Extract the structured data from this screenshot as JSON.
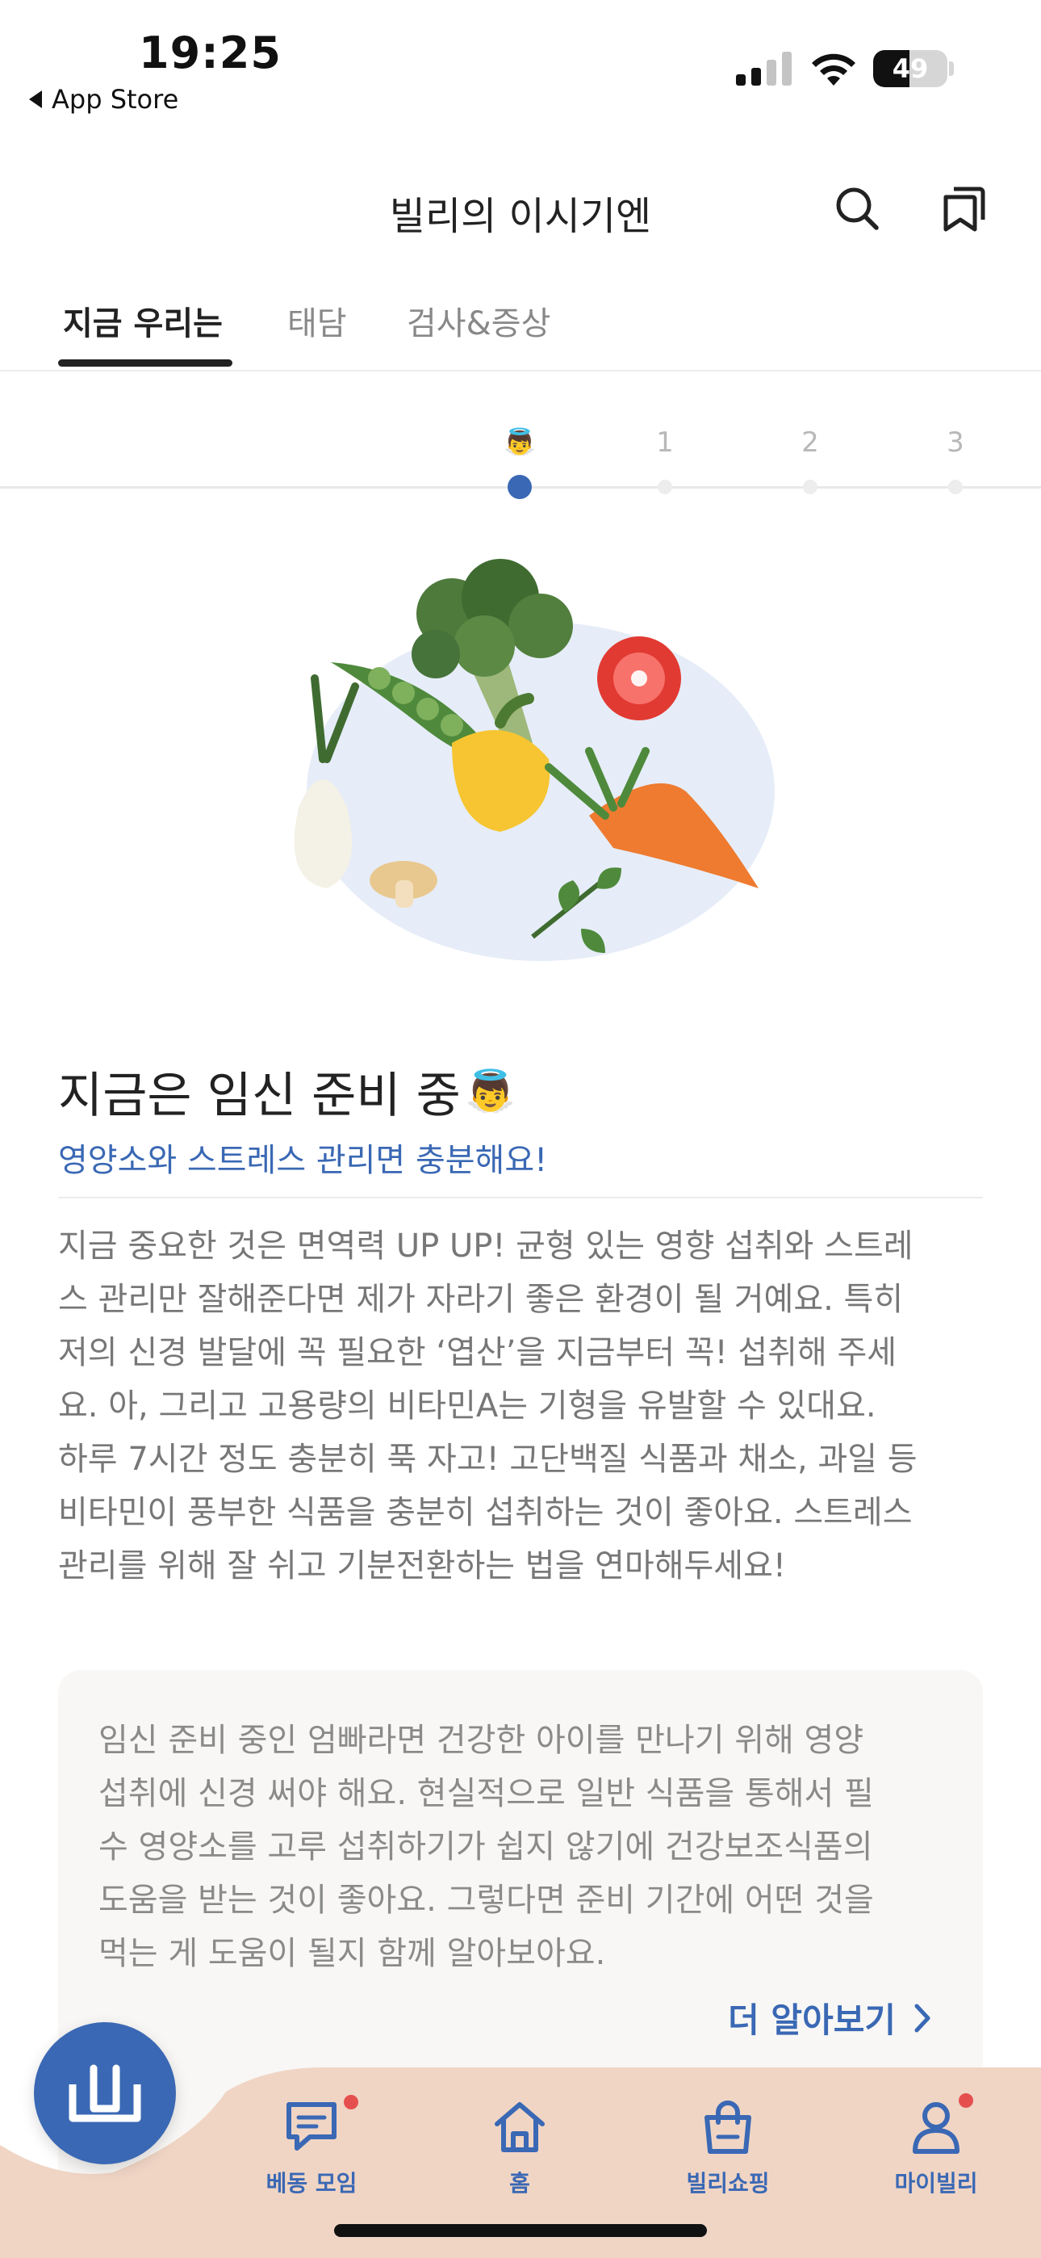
{
  "status_bar": {
    "time": "19:25",
    "back_label": "App Store",
    "battery": "49"
  },
  "header": {
    "title": "빌리의 이시기엔",
    "icons": [
      "search-icon",
      "bookmark-icon"
    ]
  },
  "tabs": [
    {
      "label": "지금 우리는",
      "active": true
    },
    {
      "label": "태담",
      "active": false
    },
    {
      "label": "검사&증상",
      "active": false
    }
  ],
  "timeline": {
    "steps": [
      "👼",
      "1",
      "2",
      "3"
    ],
    "active_index": 0
  },
  "content": {
    "heading": "지금은 임신 준비 중",
    "heading_emoji": "👼",
    "subheading": "영양소와 스트레스 관리면 충분해요!",
    "body": "지금 중요한 것은 면역력 UP UP! 균형 있는 영향 섭취와 스트레\n스 관리만 잘해준다면 제가 자라기 좋은 환경이 될 거예요. 특히\n저의 신경 발달에 꼭 필요한 ‘엽산’을 지금부터 꼭! 섭취해 주세\n요. 아, 그리고 고용량의 비타민A는 기형을 유발할 수 있대요.\n하루 7시간 정도 충분히 푹 자고! 고단백질 식품과 채소, 과일 등\n비타민이 풍부한 식품을 충분히 섭취하는 것이 좋아요. 스트레스\n관리를 위해 잘 쉬고 기분전환하는 법을 연마해두세요!"
  },
  "card": {
    "text": "임신 준비 중인 엄빠라면 건강한 아이를 만나기 위해 영양\n섭취에 신경 써야 해요. 현실적으로 일반 식품을 통해서 필\n수 영양소를 고루 섭취하기가 쉽지 않기에 건강보조식품의\n도움을 받는 것이 좋아요. 그렇다면 준비 기간에 어떤 것을\n먹는 게 도움이 될지 함께 알아보아요.",
    "more_label": "더 알아보기"
  },
  "bottom_nav": {
    "items": [
      {
        "label": "베동 모임",
        "icon": "chat-icon",
        "badge": true
      },
      {
        "label": "홈",
        "icon": "home-icon",
        "badge": false
      },
      {
        "label": "빌리쇼핑",
        "icon": "shopping-bag-icon",
        "badge": false
      },
      {
        "label": "마이빌리",
        "icon": "user-icon",
        "badge": true
      }
    ],
    "fab_icon": "book-icon"
  },
  "colors": {
    "accent": "#3a68b4",
    "nav_bg": "#f0d5c5",
    "badge": "#e5504f"
  }
}
